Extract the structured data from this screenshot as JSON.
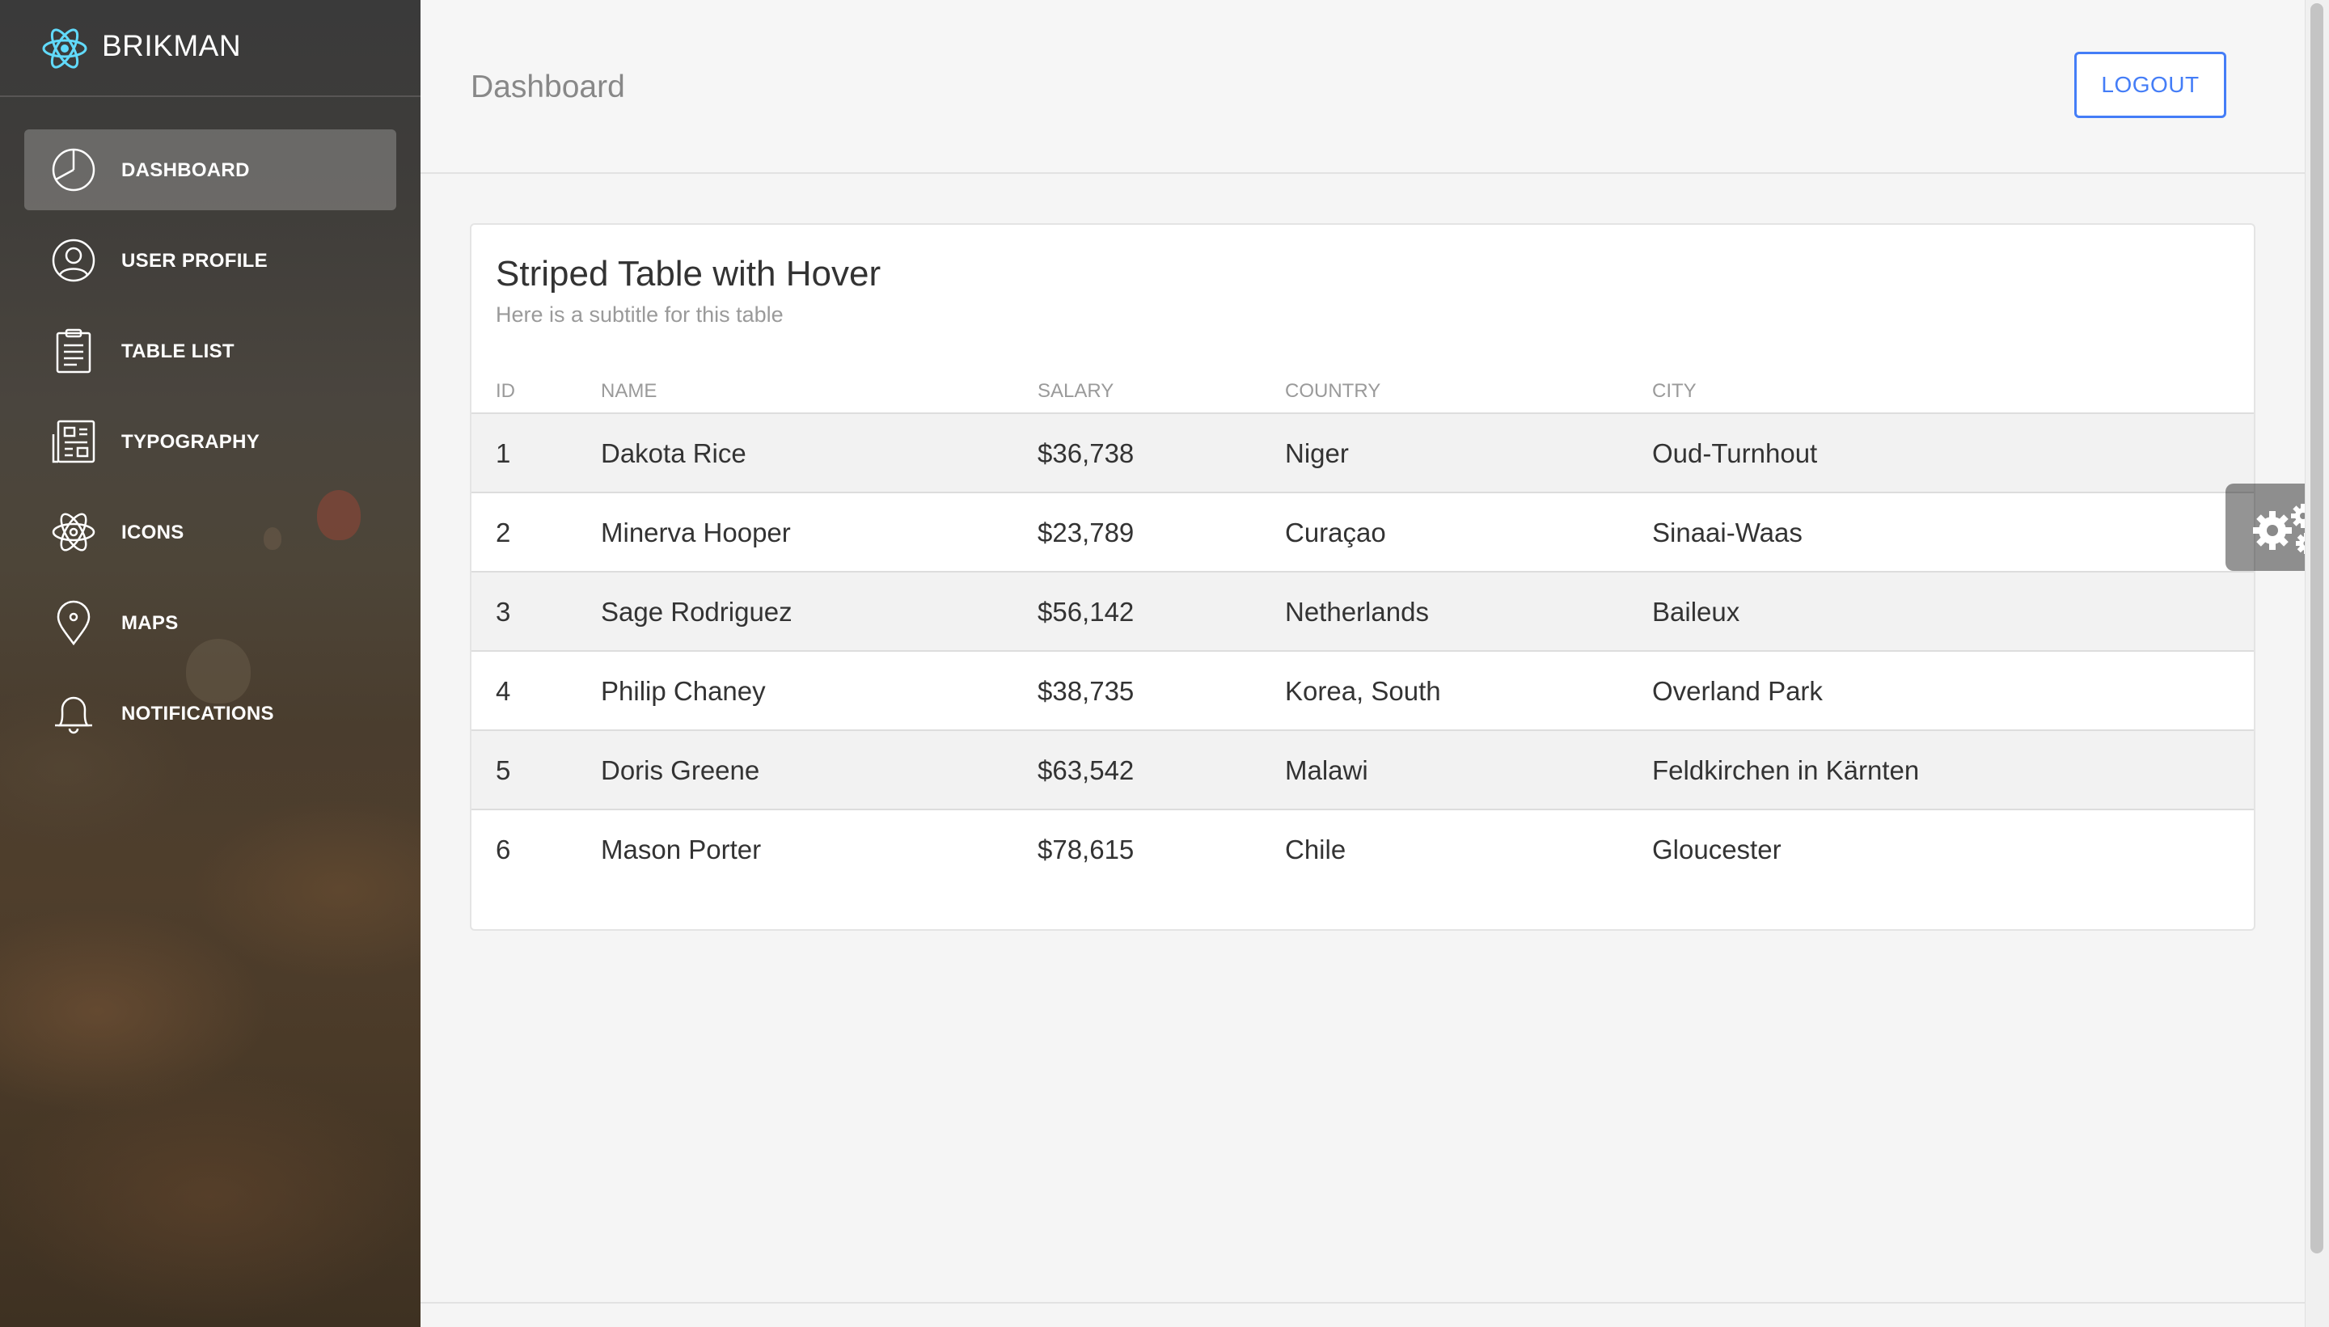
{
  "brand": {
    "name": "BRIKMAN",
    "icon": "react-atom-icon"
  },
  "sidebar": {
    "items": [
      {
        "label": "DASHBOARD",
        "icon": "pie-chart-icon",
        "active": true
      },
      {
        "label": "USER PROFILE",
        "icon": "user-circle-icon",
        "active": false
      },
      {
        "label": "TABLE LIST",
        "icon": "clipboard-list-icon",
        "active": false
      },
      {
        "label": "TYPOGRAPHY",
        "icon": "news-layout-icon",
        "active": false
      },
      {
        "label": "ICONS",
        "icon": "atom-icon",
        "active": false
      },
      {
        "label": "MAPS",
        "icon": "map-pin-icon",
        "active": false
      },
      {
        "label": "NOTIFICATIONS",
        "icon": "bell-icon",
        "active": false
      }
    ]
  },
  "header": {
    "title": "Dashboard",
    "logout_label": "LOGOUT"
  },
  "card": {
    "title": "Striped Table with Hover",
    "subtitle": "Here is a subtitle for this table",
    "columns": [
      "ID",
      "NAME",
      "SALARY",
      "COUNTRY",
      "CITY"
    ],
    "rows": [
      {
        "id": "1",
        "name": "Dakota Rice",
        "salary": "$36,738",
        "country": "Niger",
        "city": "Oud-Turnhout"
      },
      {
        "id": "2",
        "name": "Minerva Hooper",
        "salary": "$23,789",
        "country": "Curaçao",
        "city": "Sinaai-Waas"
      },
      {
        "id": "3",
        "name": "Sage Rodriguez",
        "salary": "$56,142",
        "country": "Netherlands",
        "city": "Baileux"
      },
      {
        "id": "4",
        "name": "Philip Chaney",
        "salary": "$38,735",
        "country": "Korea, South",
        "city": "Overland Park"
      },
      {
        "id": "5",
        "name": "Doris Greene",
        "salary": "$63,542",
        "country": "Malawi",
        "city": "Feldkirchen in Kärnten"
      },
      {
        "id": "6",
        "name": "Mason Porter",
        "salary": "$78,615",
        "country": "Chile",
        "city": "Gloucester"
      }
    ]
  },
  "settings_widget": {
    "icon": "gears-icon"
  },
  "colors": {
    "accent": "#447df7",
    "logo": "#61dafb",
    "row_stripe": "#f2f2f2"
  }
}
